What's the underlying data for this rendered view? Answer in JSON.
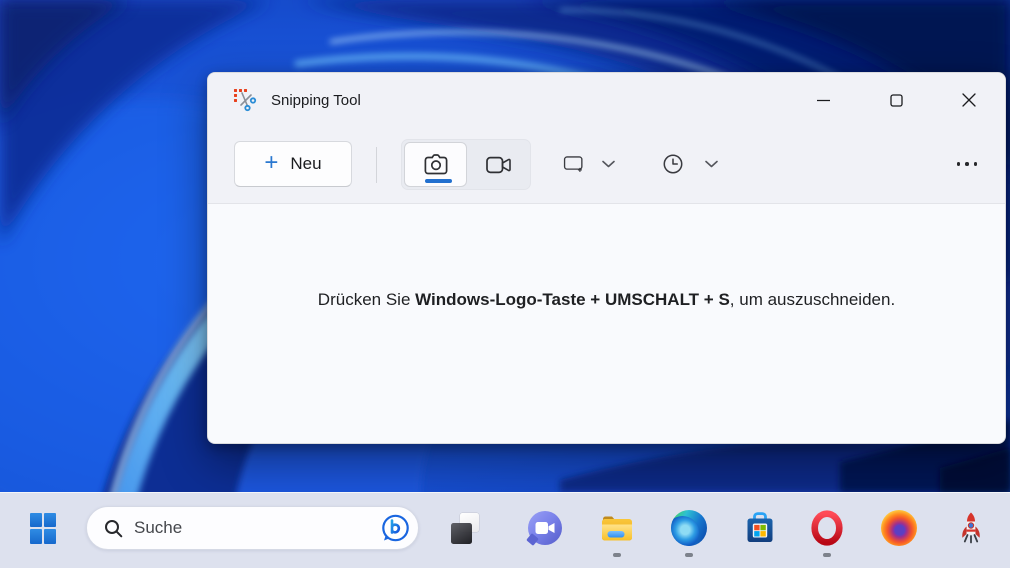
{
  "window": {
    "title": "Snipping Tool",
    "titlebar_controls": [
      "minimize",
      "maximize",
      "close"
    ],
    "toolbar": {
      "new_button": {
        "plus": "+",
        "label": "Neu"
      },
      "capture_modes": [
        "screenshot-camera",
        "video-record"
      ],
      "selected_mode": "screenshot-camera",
      "mode_dropdown_icon": "rectangle-select-icon",
      "delay_dropdown_icon": "clock-delay-icon",
      "more_icon": "ellipsis"
    },
    "hint": {
      "before": "Drücken Sie ",
      "shortcut": "Windows-Logo-Taste + UMSCHALT + S",
      "after": ", um auszuschneiden."
    }
  },
  "taskbar": {
    "start": "windows-start",
    "search": {
      "placeholder": "Suche",
      "badge": "bing-chat"
    },
    "task_view": "task-view",
    "apps": [
      {
        "name": "chat",
        "running": false
      },
      {
        "name": "file-explorer",
        "running": true
      },
      {
        "name": "edge",
        "running": true
      },
      {
        "name": "microsoft-store",
        "running": false
      },
      {
        "name": "opera",
        "running": true
      },
      {
        "name": "firefox",
        "running": false
      },
      {
        "name": "rocket-app",
        "running": false
      }
    ]
  },
  "colors": {
    "accent_blue": "#2270cf",
    "window_chrome": "#f1f2f7",
    "window_content": "#f9fafd",
    "taskbar_bg": "#dde1ee",
    "wallpaper_bright": "#1b5de6",
    "wallpaper_dark": "#081f78"
  }
}
